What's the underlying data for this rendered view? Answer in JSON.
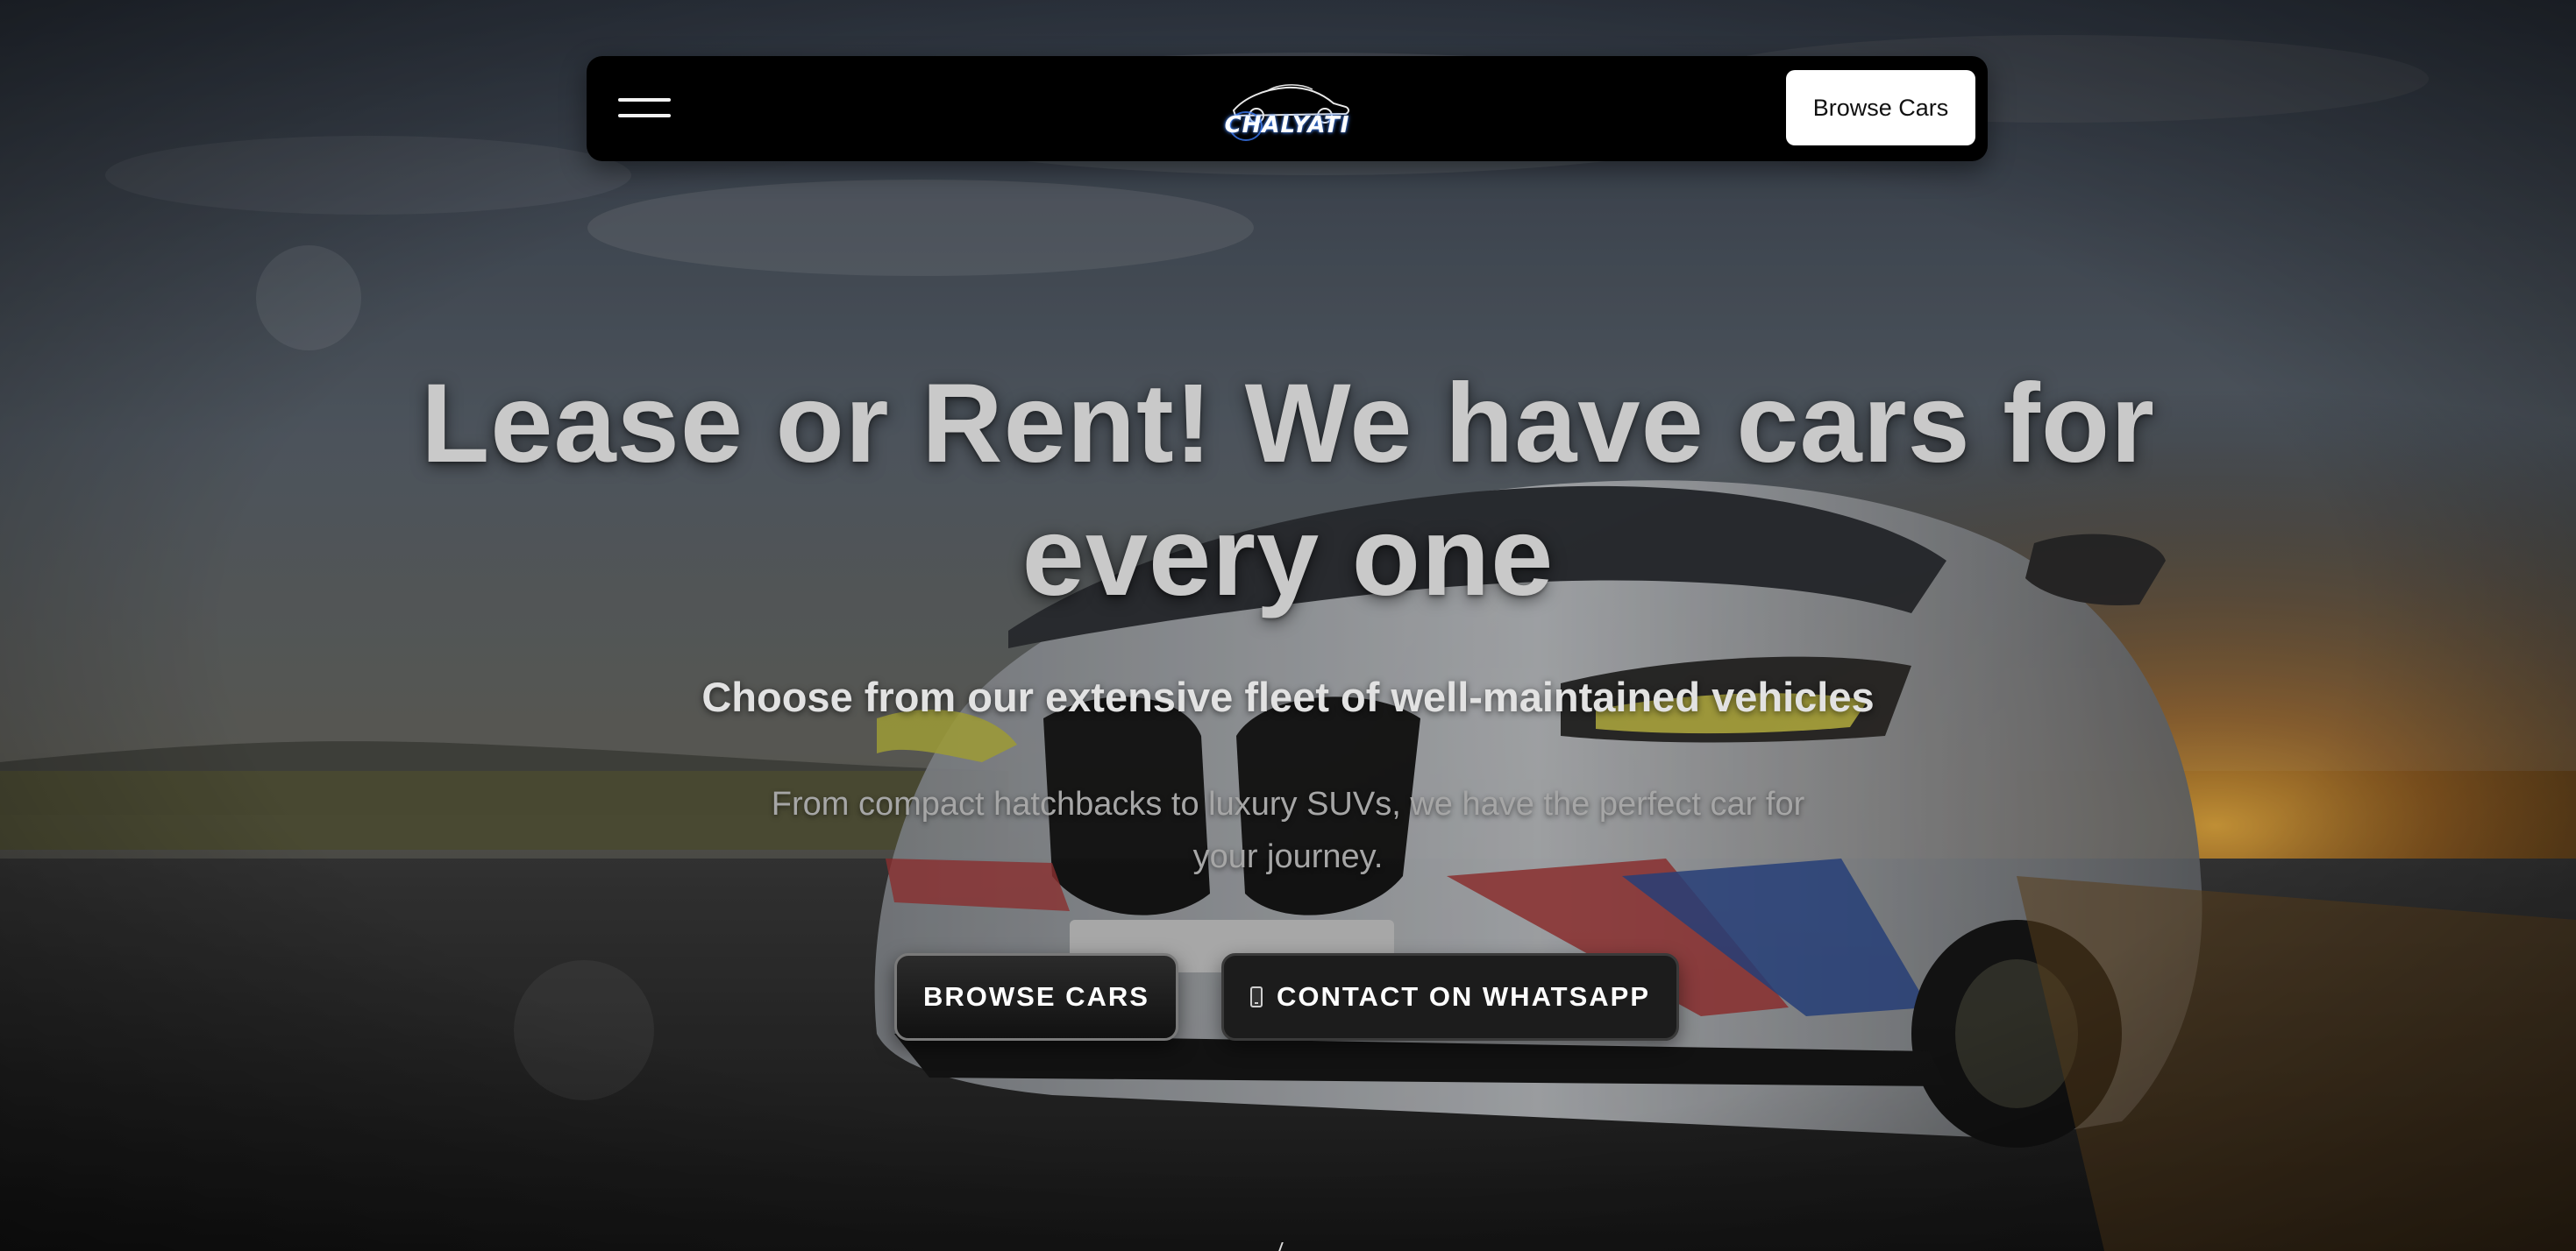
{
  "navbar": {
    "menu_icon": "hamburger-menu-icon",
    "logo_text": "CHALYATI",
    "browse_button_label": "Browse Cars"
  },
  "hero": {
    "title": "Lease or Rent! We have cars for every one",
    "subtitle": "Choose from our extensive fleet of well-maintained vehicles",
    "description": "From compact hatchbacks to luxury SUVs, we have the perfect car for your journey.",
    "primary_cta_label": "BROWSE CARS",
    "secondary_cta_icon": "mobile-phone-icon",
    "secondary_cta_label": "CONTACT ON WHATSAPP"
  },
  "colors": {
    "navbar_background": "#000000",
    "nav_button_background": "#ffffff",
    "title_color": "#c9c9c9",
    "cta_background": "#1c1c1c"
  }
}
